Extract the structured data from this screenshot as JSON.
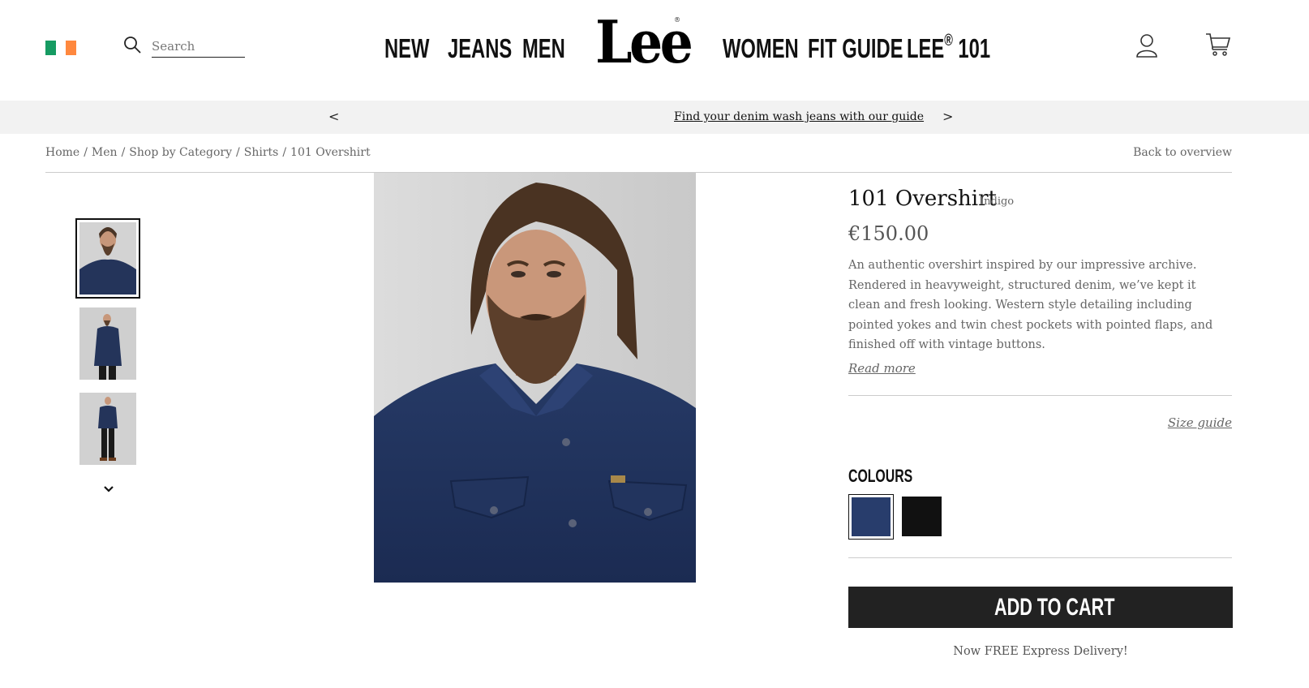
{
  "header": {
    "flag_colors": [
      "#169b62",
      "#ffffff",
      "#ff883e"
    ],
    "search_placeholder": "Search",
    "nav_left": [
      "NEW",
      "JEANS",
      "MEN"
    ],
    "logo": "Lee",
    "logo_mark": "®",
    "nav_right": [
      "WOMEN",
      "FIT GUIDE"
    ],
    "nav_lee101_prefix": "LEE",
    "nav_lee101_sup": "®",
    "nav_lee101_suffix": " 101",
    "account_icon": "user-icon",
    "cart_icon": "cart-icon"
  },
  "promo": {
    "prev": "<",
    "text": "Find your denim wash jeans with our guide",
    "next": ">"
  },
  "breadcrumb": {
    "items": [
      "Home",
      "Men",
      "Shop by Category",
      "Shirts",
      "101 Overshirt"
    ],
    "separator": "/",
    "back": "Back to overview"
  },
  "gallery": {
    "thumbnail_count": 3,
    "selected_index": 0
  },
  "product": {
    "name": "101 Overshirt",
    "color_name": "Indigo",
    "price": "€150.00",
    "description": "An authentic overshirt inspired by our impressive archive. Rendered in heavyweight, structured denim, we’ve kept it clean and fresh looking. Western style detailing including pointed yokes and twin chest pockets with pointed flaps, and finished off with vintage buttons.",
    "read_more": "Read more",
    "size_guide": "Size guide",
    "colours_label": "COLOURS",
    "swatches": [
      {
        "color": "#283d6c",
        "selected": true
      },
      {
        "color": "#111111",
        "selected": false
      }
    ],
    "add_to_cart": "ADD TO CART",
    "delivery": "Now FREE Express Delivery!"
  }
}
